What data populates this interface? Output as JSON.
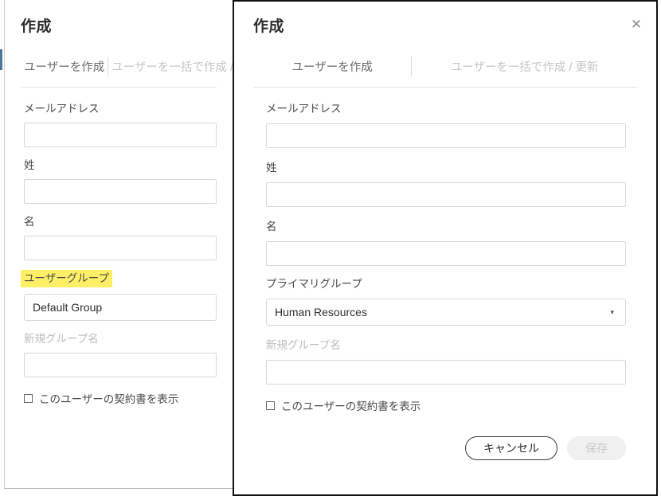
{
  "left_dialog": {
    "title": "作成",
    "tabs": [
      {
        "label": "ユーザーを作成",
        "active": true
      },
      {
        "label": "ユーザーを一括で作成 / 更新",
        "active": false
      }
    ],
    "fields": {
      "email_label": "メールアドレス",
      "email_value": "",
      "lastname_label": "姓",
      "lastname_value": "",
      "firstname_label": "名",
      "firstname_value": "",
      "group_label": "ユーザーグループ",
      "group_value": "Default Group",
      "newgroup_label": "新規グループ名",
      "newgroup_value": ""
    },
    "checkbox_label": "このユーザーの契約書を表示",
    "highlight_color": "#ffef66"
  },
  "right_dialog": {
    "title": "作成",
    "close_icon": "close-icon",
    "close_glyph": "✕",
    "tabs": [
      {
        "label": "ユーザーを作成",
        "active": true
      },
      {
        "label": "ユーザーを一括で作成 / 更新",
        "active": false
      }
    ],
    "fields": {
      "email_label": "メールアドレス",
      "email_value": "",
      "lastname_label": "姓",
      "lastname_value": "",
      "firstname_label": "名",
      "firstname_value": "",
      "primary_group_label": "プライマリグループ",
      "primary_group_value": "Human Resources",
      "primary_group_caret": "▾",
      "newgroup_label": "新規グループ名",
      "newgroup_value": ""
    },
    "checkbox_label": "このユーザーの契約書を表示",
    "buttons": {
      "cancel_label": "キャンセル",
      "save_label": "保存"
    }
  }
}
